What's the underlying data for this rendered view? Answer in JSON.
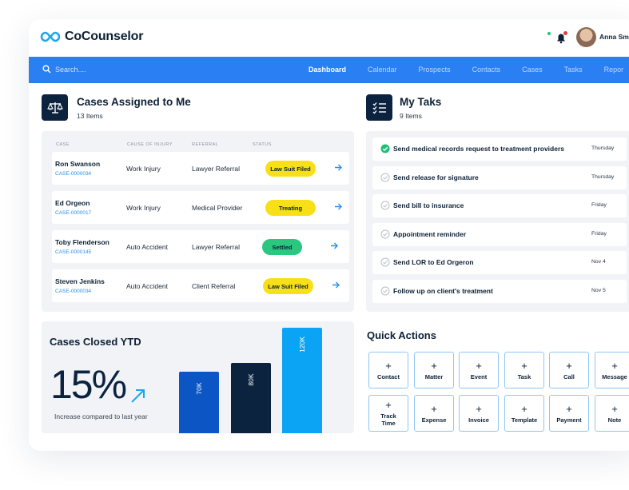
{
  "app": {
    "name": "CoCounselor",
    "user_name": "Anna Smit"
  },
  "nav": {
    "search_placeholder": "Search....",
    "items": [
      {
        "label": "Dashboard",
        "active": true
      },
      {
        "label": "Calendar",
        "active": false
      },
      {
        "label": "Prospects",
        "active": false
      },
      {
        "label": "Contacts",
        "active": false
      },
      {
        "label": "Cases",
        "active": false
      },
      {
        "label": "Tasks",
        "active": false
      },
      {
        "label": "Repor",
        "active": false
      }
    ]
  },
  "cases": {
    "title": "Cases Assigned to Me",
    "count": "13 Items",
    "columns": [
      "CASE",
      "CAUSE OF INJURY",
      "REFERRAL",
      "STATUS"
    ],
    "rows": [
      {
        "name": "Ron Swanson",
        "id": "CASE-0000034",
        "injury": "Work Injury",
        "referral": "Lawyer Referral",
        "status": "Law Suit Filed",
        "status_color": "yellow"
      },
      {
        "name": "Ed Orgeon",
        "id": "CASE-0000017",
        "injury": "Work Injury",
        "referral": "Medical Provider",
        "status": "Treating",
        "status_color": "yellow"
      },
      {
        "name": "Toby Flenderson",
        "id": "CASE-0000145",
        "injury": "Auto Accident",
        "referral": "Lawyer Referral",
        "status": "Settled",
        "status_color": "green"
      },
      {
        "name": "Steven Jenkins",
        "id": "CASE-0000034",
        "injury": "Auto Accident",
        "referral": "Client Referral",
        "status": "Law Suit Filed",
        "status_color": "yellow"
      }
    ]
  },
  "tasks": {
    "title": "My Taks",
    "count": "9 Items",
    "items": [
      {
        "label": "Send medical records request to treatment providers",
        "date": "Thursday",
        "done": true
      },
      {
        "label": "Send release for signature",
        "date": "Thursday",
        "done": false
      },
      {
        "label": "Send bill to insurance",
        "date": "Friday",
        "done": false
      },
      {
        "label": "Appointment reminder",
        "date": "Friday",
        "done": false
      },
      {
        "label": "Send LOR to Ed Orgeron",
        "date": "Nov 4",
        "done": false
      },
      {
        "label": "Follow up on client's treatment",
        "date": "Nov 5",
        "done": false
      }
    ]
  },
  "closed_ytd": {
    "title": "Cases Closed YTD",
    "percent": "15%",
    "caption": "Increase compared to last year",
    "bars": [
      {
        "label": "70K",
        "value": 70,
        "color": "#0b56c4"
      },
      {
        "label": "80K",
        "value": 80,
        "color": "#0c2340"
      },
      {
        "label": "120K",
        "value": 120,
        "color": "#0ba4f5"
      }
    ]
  },
  "quick_actions": {
    "title": "Quick Actions",
    "plus": "+",
    "items": [
      "Contact",
      "Matter",
      "Event",
      "Task",
      "Call",
      "Message",
      "Track Time",
      "Expense",
      "Invoice",
      "Template",
      "Payment",
      "Note"
    ]
  },
  "colors": {
    "accent": "#2a7ff2",
    "navy": "#0c2340",
    "yellow_badge": "#f7e017",
    "green_badge": "#2bc77f"
  }
}
